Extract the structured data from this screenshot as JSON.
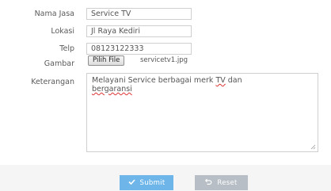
{
  "fields": {
    "nama_jasa": {
      "label": "Nama Jasa",
      "value": "Service TV"
    },
    "lokasi": {
      "label": "Lokasi",
      "value": "Jl Raya Kediri"
    },
    "telp": {
      "label": "Telp",
      "value": "08123122333"
    },
    "gambar": {
      "label": "Gambar",
      "button": "Pilih File",
      "filename": "servicetv1.jpg"
    },
    "keterangan": {
      "label": "Keterangan",
      "text_part1": "Melayani Service berbagai merk ",
      "text_tv": "TV",
      "text_part2": " dan",
      "text_line2": "bergaransi"
    }
  },
  "buttons": {
    "submit": {
      "label": "Submit",
      "icon": "check-icon",
      "color": "#6eb6ea"
    },
    "reset": {
      "label": "Reset",
      "icon": "undo-icon",
      "color": "#b7bec5"
    }
  }
}
